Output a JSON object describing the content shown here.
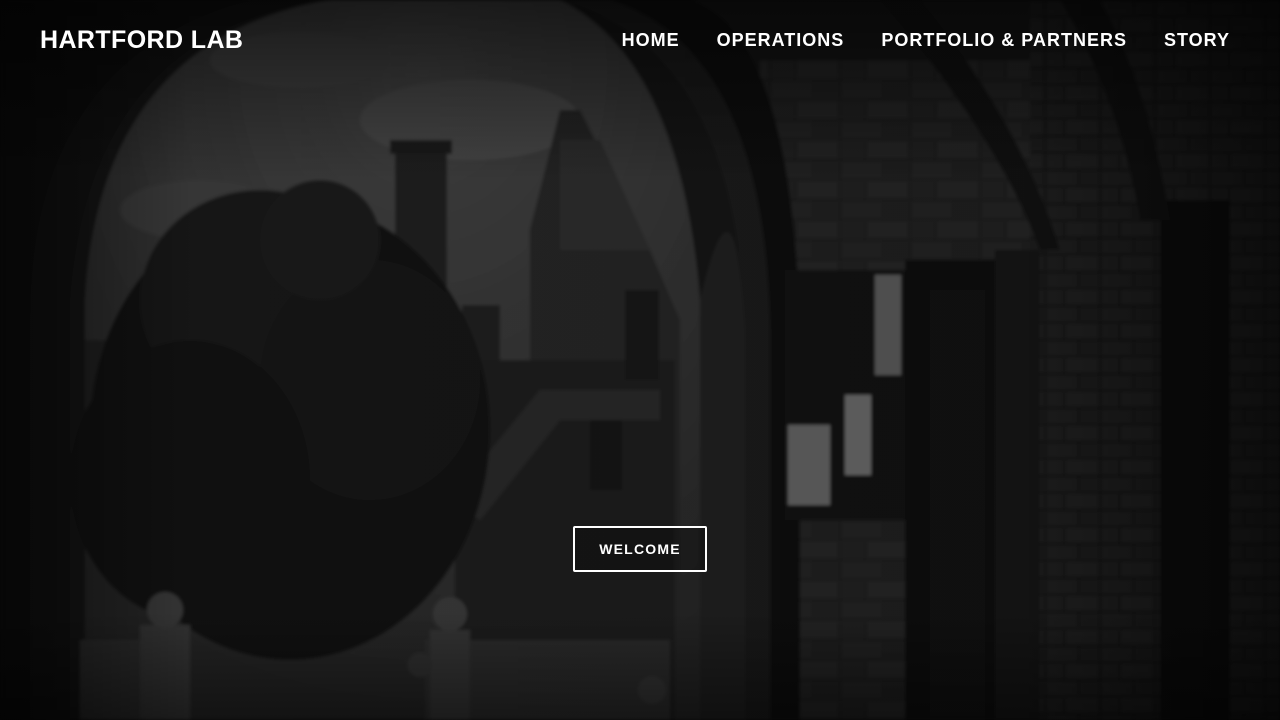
{
  "brand": {
    "name": "HARTFORD LAB"
  },
  "nav": {
    "items": [
      {
        "label": "HOME"
      },
      {
        "label": "OPERATIONS"
      },
      {
        "label": "PORTFOLIO & PARTNERS"
      },
      {
        "label": "STORY"
      }
    ]
  },
  "hero": {
    "cta_label": "WELCOME",
    "background": "dark-tinted-gothic-stone-archway-photo"
  },
  "colors": {
    "text": "#ffffff",
    "overlay": "#000000"
  }
}
